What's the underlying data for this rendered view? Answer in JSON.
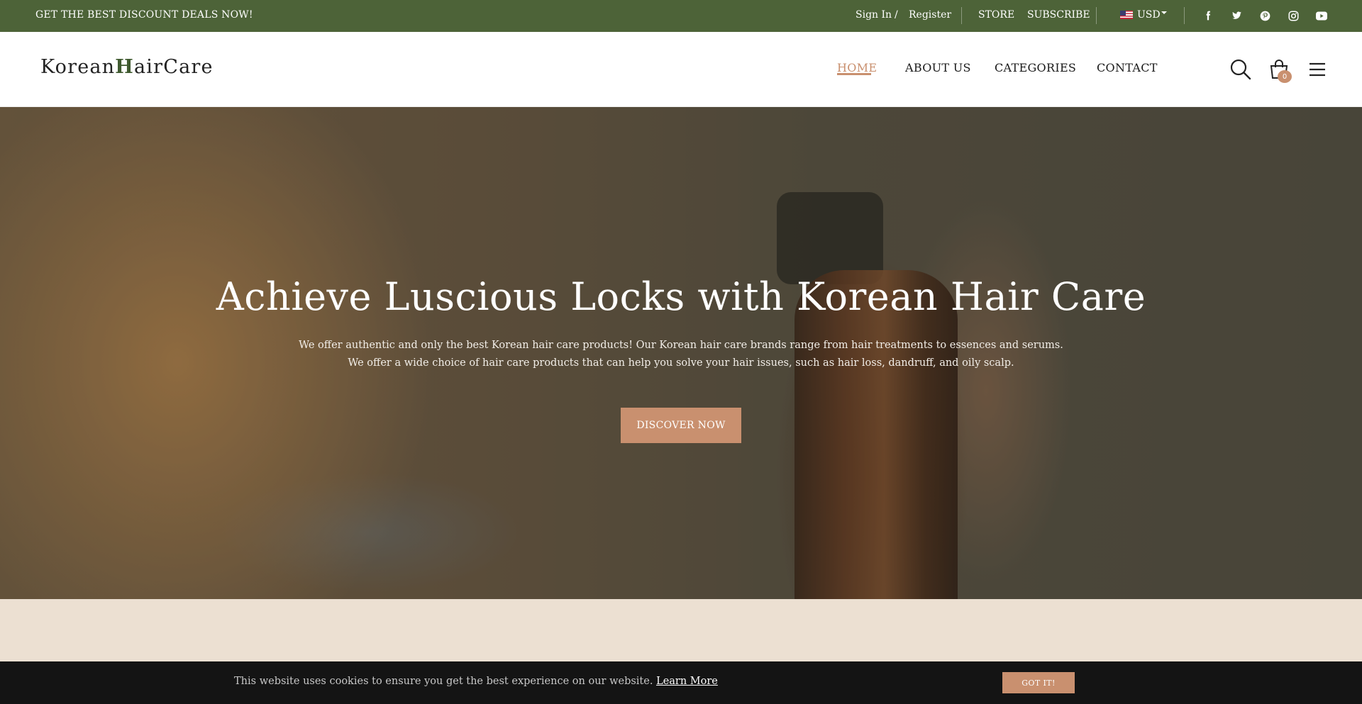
{
  "topbar": {
    "promo": "GET THE BEST DISCOUNT DEALS NOW!",
    "sign_in": "Sign In",
    "slash": "/",
    "register": "Register",
    "store": "STORE",
    "subscribe": "SUBSCRIBE",
    "currency": "USD",
    "social": [
      "facebook-icon",
      "twitter-icon",
      "pinterest-icon",
      "instagram-icon",
      "youtube-icon"
    ],
    "bg_color": "#4d6338"
  },
  "header": {
    "logo_pre": "Korean",
    "logo_h": "H",
    "logo_post": "airCare",
    "nav": [
      "HOME",
      "ABOUT US",
      "CATEGORIES",
      "CONTACT"
    ],
    "active_nav": "HOME",
    "cart_count": "0"
  },
  "hero": {
    "title": "Achieve Luscious Locks with Korean Hair Care",
    "line1": "We offer authentic and only the best Korean hair care products! Our Korean hair care brands range from hair treatments to essences and serums.",
    "line2": "We offer a wide choice of hair care products that can help you solve your hair issues, such as hair loss, dandruff, and oily scalp.",
    "cta": "DISCOVER NOW"
  },
  "cookie": {
    "message": "This website uses cookies to ensure you get the best experience on our website.",
    "learn_more": "Learn More",
    "button": "GOT IT!"
  },
  "colors": {
    "accent": "#c9906f",
    "band": "#ece0d2",
    "cookie_bg": "#141414"
  }
}
